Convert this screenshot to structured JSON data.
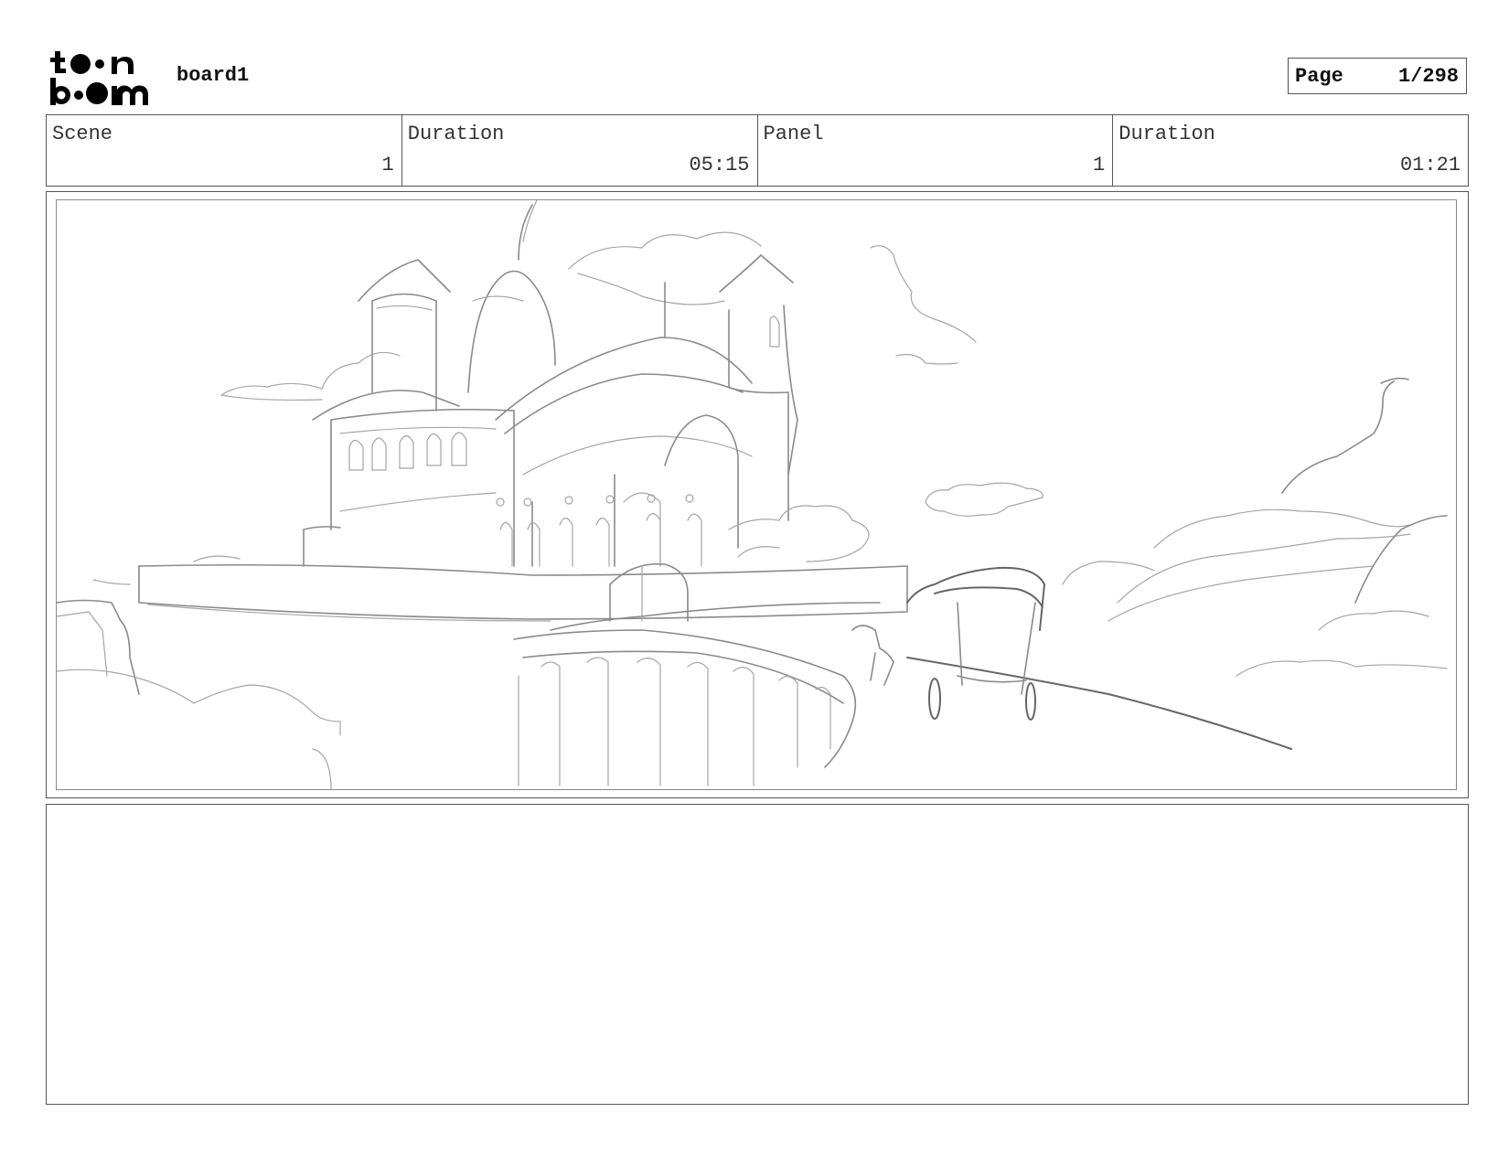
{
  "header": {
    "logo_text": "toonboom",
    "board_title": "board1",
    "page_label": "Page",
    "page_value": "1/298"
  },
  "info": {
    "scene_label": "Scene",
    "scene_value": "1",
    "scene_duration_label": "Duration",
    "scene_duration_value": "05:15",
    "panel_label": "Panel",
    "panel_value": "1",
    "panel_duration_label": "Duration",
    "panel_duration_value": "01:21"
  },
  "notes": {
    "text": ""
  }
}
